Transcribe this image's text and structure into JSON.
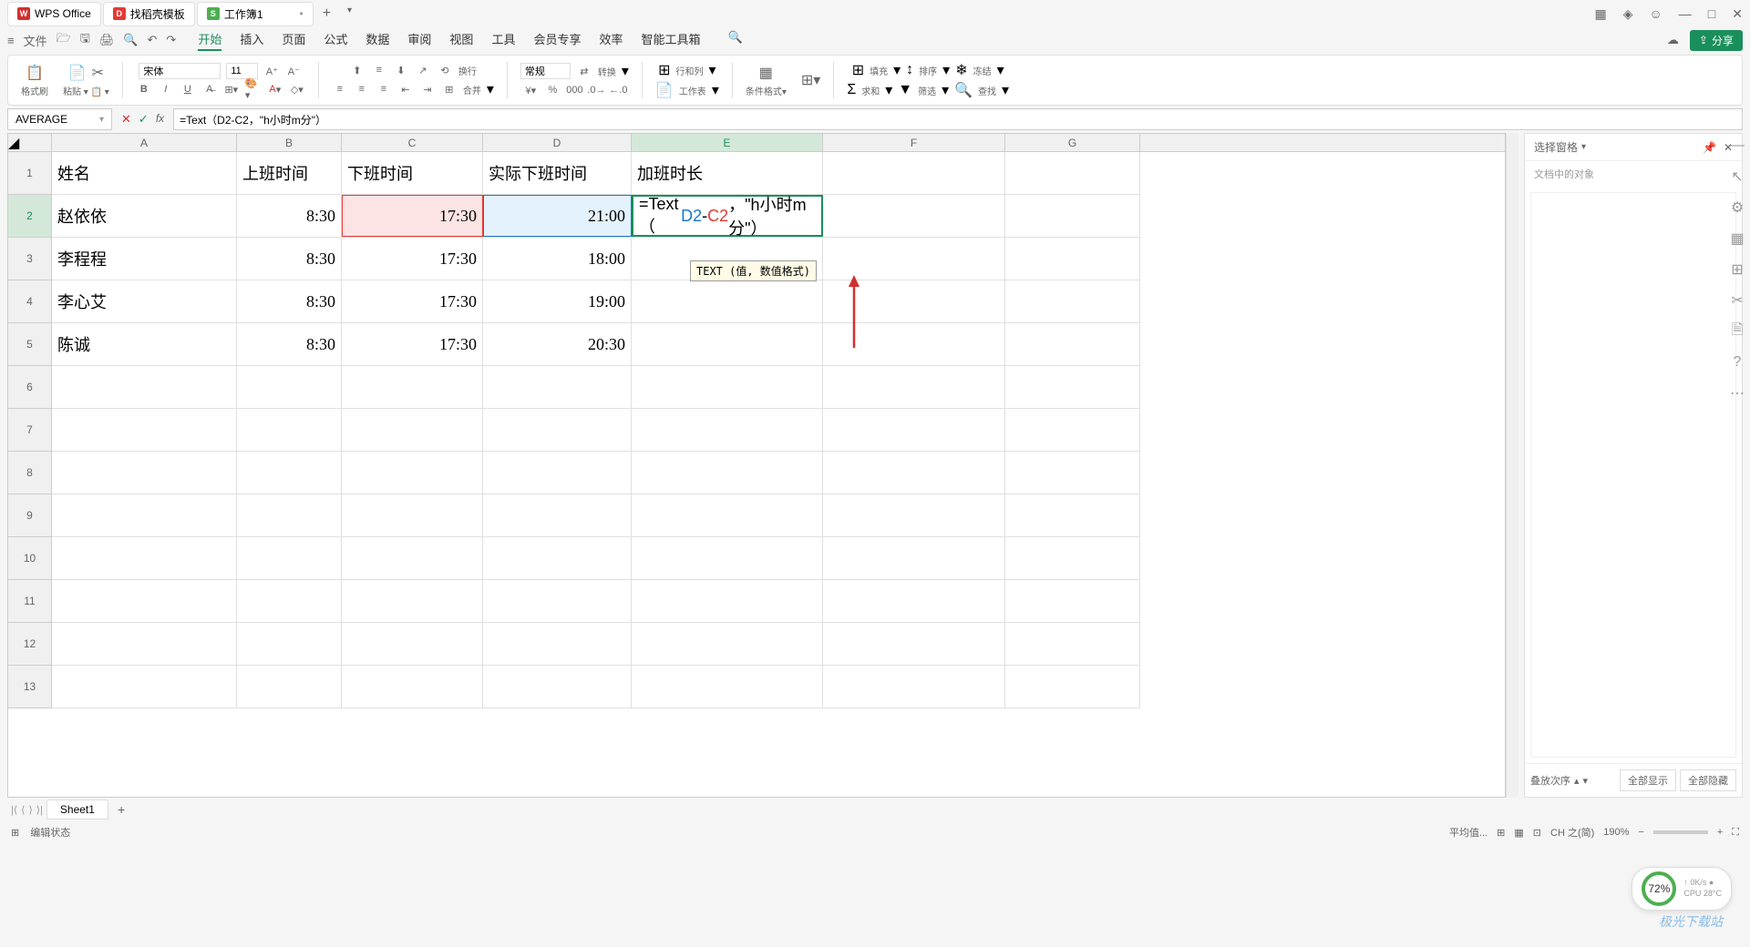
{
  "chart_data": {
    "type": "table",
    "columns": [
      "姓名",
      "上班时间",
      "下班时间",
      "实际下班时间",
      "加班时长"
    ],
    "rows": [
      [
        "赵依依",
        "8:30",
        "17:30",
        "21:00",
        ""
      ],
      [
        "李程程",
        "8:30",
        "17:30",
        "18:00",
        ""
      ],
      [
        "李心艾",
        "8:30",
        "17:30",
        "19:00",
        ""
      ],
      [
        "陈诚",
        "8:30",
        "17:30",
        "20:30",
        ""
      ]
    ],
    "active_formula": "=Text（D2-C2，\"h小时m分\"）",
    "active_cell": "E2"
  },
  "title_bar": {
    "tabs": {
      "wps": "WPS Office",
      "template": "找稻壳模板",
      "workbook": "工作簿1"
    }
  },
  "menu": {
    "file": "文件",
    "start": "开始",
    "insert": "插入",
    "page": "页面",
    "formula": "公式",
    "data": "数据",
    "review": "审阅",
    "view": "视图",
    "tools": "工具",
    "member": "会员专享",
    "efficiency": "效率",
    "smart": "智能工具箱",
    "share": "分享"
  },
  "ribbon": {
    "format_brush": "格式刷",
    "paste": "粘贴",
    "font_name": "宋体",
    "font_size": "11",
    "wrap": "换行",
    "general": "常规",
    "convert": "转换",
    "merge": "合并",
    "rowcol": "行和列",
    "worksheet": "工作表",
    "cond_format": "条件格式",
    "fill": "填充",
    "sort": "排序",
    "freeze": "冻结",
    "sum": "求和",
    "filter": "筛选",
    "find": "查找"
  },
  "formula_bar": {
    "name": "AVERAGE",
    "formula": "=Text（D2-C2，\"h小时m分\"）"
  },
  "cols": {
    "a": "A",
    "b": "B",
    "c": "C",
    "d": "D",
    "e": "E",
    "f": "F",
    "g": "G"
  },
  "rows": {
    "r1": "1",
    "r2": "2",
    "r3": "3",
    "r4": "4",
    "r5": "5",
    "r6": "6",
    "r7": "7",
    "r8": "8",
    "r9": "9",
    "r10": "10",
    "r11": "11",
    "r12": "12",
    "r13": "13"
  },
  "headers": {
    "name": "姓名",
    "start": "上班时间",
    "end": "下班时间",
    "actual": "实际下班时间",
    "overtime": "加班时长"
  },
  "data": {
    "r2": {
      "a": "赵依依",
      "b": "8:30",
      "c": "17:30",
      "d": "21:00"
    },
    "r3": {
      "a": "李程程",
      "b": "8:30",
      "c": "17:30",
      "d": "18:00"
    },
    "r4": {
      "a": "李心艾",
      "b": "8:30",
      "c": "17:30",
      "d": "19:00"
    },
    "r5": {
      "a": "陈诚",
      "b": "8:30",
      "c": "17:30",
      "d": "20:30"
    }
  },
  "editing": {
    "prefix": "=Text（",
    "d2": "D2",
    "minus": "-",
    "c2": "C2",
    "suffix": "，\"h小时m分\"）"
  },
  "tooltip": "TEXT (值, 数值格式)",
  "right_panel": {
    "title": "选择窗格",
    "sub": "文档中的对象",
    "order": "叠放次序",
    "show_all": "全部显示",
    "hide_all": "全部隐藏"
  },
  "sheet_tabs": {
    "sheet1": "Sheet1"
  },
  "status": {
    "mode": "编辑状态",
    "avg": "平均值...",
    "zoom": "190%"
  },
  "perf": {
    "pct": "72%",
    "net": "0K/s",
    "cpu": "CPU 28°C"
  },
  "watermark": "极光下载站",
  "ime": "CH 之(简)"
}
